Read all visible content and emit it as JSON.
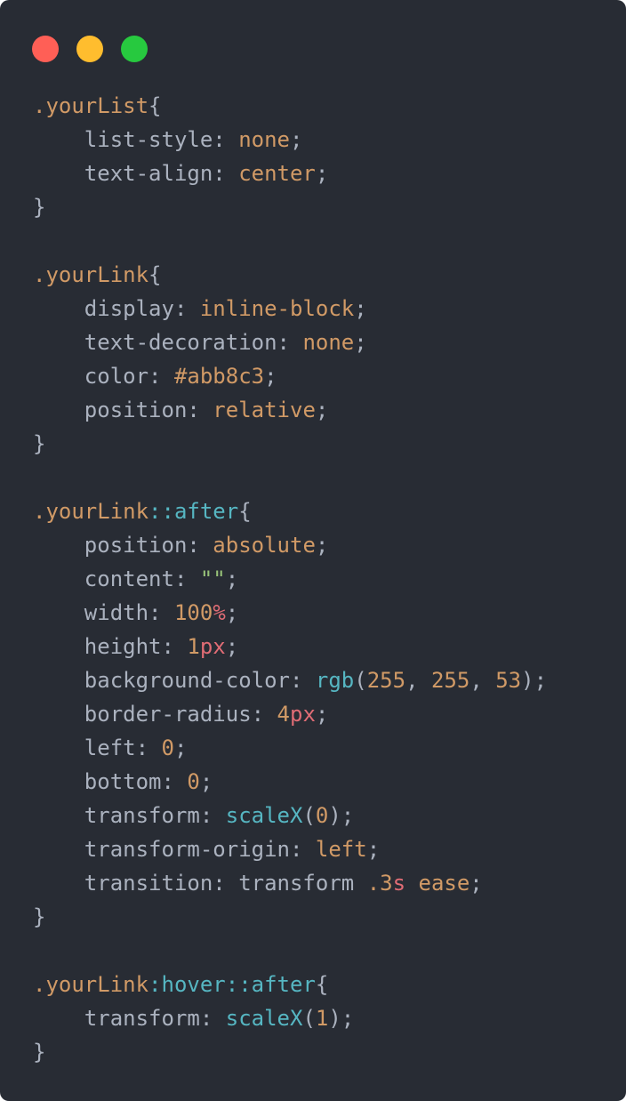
{
  "window": {
    "dots": [
      {
        "name": "close",
        "color": "#ff5f56"
      },
      {
        "name": "minimize",
        "color": "#ffbd2e"
      },
      {
        "name": "maximize",
        "color": "#27c93f"
      }
    ]
  },
  "theme": {
    "background": "#282c34",
    "selector": "#d19a66",
    "pseudo": "#56b6c2",
    "property": "#abb2bf",
    "value": "#d19a66",
    "unit": "#e06c75",
    "function": "#56b6c2",
    "string": "#98c379"
  },
  "code_lines": [
    [
      {
        "t": ".yourList",
        "c": "sel"
      },
      {
        "t": "{",
        "c": "punc"
      }
    ],
    [
      {
        "t": "    list-style: ",
        "c": "prop"
      },
      {
        "t": "none",
        "c": "val"
      },
      {
        "t": ";",
        "c": "punc"
      }
    ],
    [
      {
        "t": "    text-align: ",
        "c": "prop"
      },
      {
        "t": "center",
        "c": "val"
      },
      {
        "t": ";",
        "c": "punc"
      }
    ],
    [
      {
        "t": "}",
        "c": "punc"
      }
    ],
    [],
    [
      {
        "t": ".yourLink",
        "c": "sel"
      },
      {
        "t": "{",
        "c": "punc"
      }
    ],
    [
      {
        "t": "    display: ",
        "c": "prop"
      },
      {
        "t": "inline-block",
        "c": "val"
      },
      {
        "t": ";",
        "c": "punc"
      }
    ],
    [
      {
        "t": "    text-decoration: ",
        "c": "prop"
      },
      {
        "t": "none",
        "c": "val"
      },
      {
        "t": ";",
        "c": "punc"
      }
    ],
    [
      {
        "t": "    color: ",
        "c": "prop"
      },
      {
        "t": "#abb8c3",
        "c": "val"
      },
      {
        "t": ";",
        "c": "punc"
      }
    ],
    [
      {
        "t": "    position: ",
        "c": "prop"
      },
      {
        "t": "relative",
        "c": "val"
      },
      {
        "t": ";",
        "c": "punc"
      }
    ],
    [
      {
        "t": "}",
        "c": "punc"
      }
    ],
    [],
    [
      {
        "t": ".yourLink",
        "c": "sel"
      },
      {
        "t": "::after",
        "c": "pseudo"
      },
      {
        "t": "{",
        "c": "punc"
      }
    ],
    [
      {
        "t": "    position: ",
        "c": "prop"
      },
      {
        "t": "absolute",
        "c": "val"
      },
      {
        "t": ";",
        "c": "punc"
      }
    ],
    [
      {
        "t": "    content: ",
        "c": "prop"
      },
      {
        "t": "\"\"",
        "c": "str"
      },
      {
        "t": ";",
        "c": "punc"
      }
    ],
    [
      {
        "t": "    width: ",
        "c": "prop"
      },
      {
        "t": "100",
        "c": "num"
      },
      {
        "t": "%",
        "c": "unit"
      },
      {
        "t": ";",
        "c": "punc"
      }
    ],
    [
      {
        "t": "    height: ",
        "c": "prop"
      },
      {
        "t": "1",
        "c": "num"
      },
      {
        "t": "px",
        "c": "unit"
      },
      {
        "t": ";",
        "c": "punc"
      }
    ],
    [
      {
        "t": "    background-color: ",
        "c": "prop"
      },
      {
        "t": "rgb",
        "c": "fn"
      },
      {
        "t": "(",
        "c": "punc"
      },
      {
        "t": "255",
        "c": "num"
      },
      {
        "t": ", ",
        "c": "punc"
      },
      {
        "t": "255",
        "c": "num"
      },
      {
        "t": ", ",
        "c": "punc"
      },
      {
        "t": "53",
        "c": "num"
      },
      {
        "t": ");",
        "c": "punc"
      }
    ],
    [
      {
        "t": "    border-radius: ",
        "c": "prop"
      },
      {
        "t": "4",
        "c": "num"
      },
      {
        "t": "px",
        "c": "unit"
      },
      {
        "t": ";",
        "c": "punc"
      }
    ],
    [
      {
        "t": "    left: ",
        "c": "prop"
      },
      {
        "t": "0",
        "c": "num"
      },
      {
        "t": ";",
        "c": "punc"
      }
    ],
    [
      {
        "t": "    bottom: ",
        "c": "prop"
      },
      {
        "t": "0",
        "c": "num"
      },
      {
        "t": ";",
        "c": "punc"
      }
    ],
    [
      {
        "t": "    transform: ",
        "c": "prop"
      },
      {
        "t": "scaleX",
        "c": "fn"
      },
      {
        "t": "(",
        "c": "punc"
      },
      {
        "t": "0",
        "c": "num"
      },
      {
        "t": ");",
        "c": "punc"
      }
    ],
    [
      {
        "t": "    transform-origin: ",
        "c": "prop"
      },
      {
        "t": "left",
        "c": "val"
      },
      {
        "t": ";",
        "c": "punc"
      }
    ],
    [
      {
        "t": "    transition: ",
        "c": "prop"
      },
      {
        "t": "transform ",
        "c": "prop"
      },
      {
        "t": ".3",
        "c": "num"
      },
      {
        "t": "s",
        "c": "unit"
      },
      {
        "t": " ",
        "c": "prop"
      },
      {
        "t": "ease",
        "c": "val"
      },
      {
        "t": ";",
        "c": "punc"
      }
    ],
    [
      {
        "t": "}",
        "c": "punc"
      }
    ],
    [],
    [
      {
        "t": ".yourLink",
        "c": "sel"
      },
      {
        "t": ":hover::after",
        "c": "pseudo"
      },
      {
        "t": "{",
        "c": "punc"
      }
    ],
    [
      {
        "t": "    transform: ",
        "c": "prop"
      },
      {
        "t": "scaleX",
        "c": "fn"
      },
      {
        "t": "(",
        "c": "punc"
      },
      {
        "t": "1",
        "c": "num"
      },
      {
        "t": ");",
        "c": "punc"
      }
    ],
    [
      {
        "t": "}",
        "c": "punc"
      }
    ]
  ]
}
